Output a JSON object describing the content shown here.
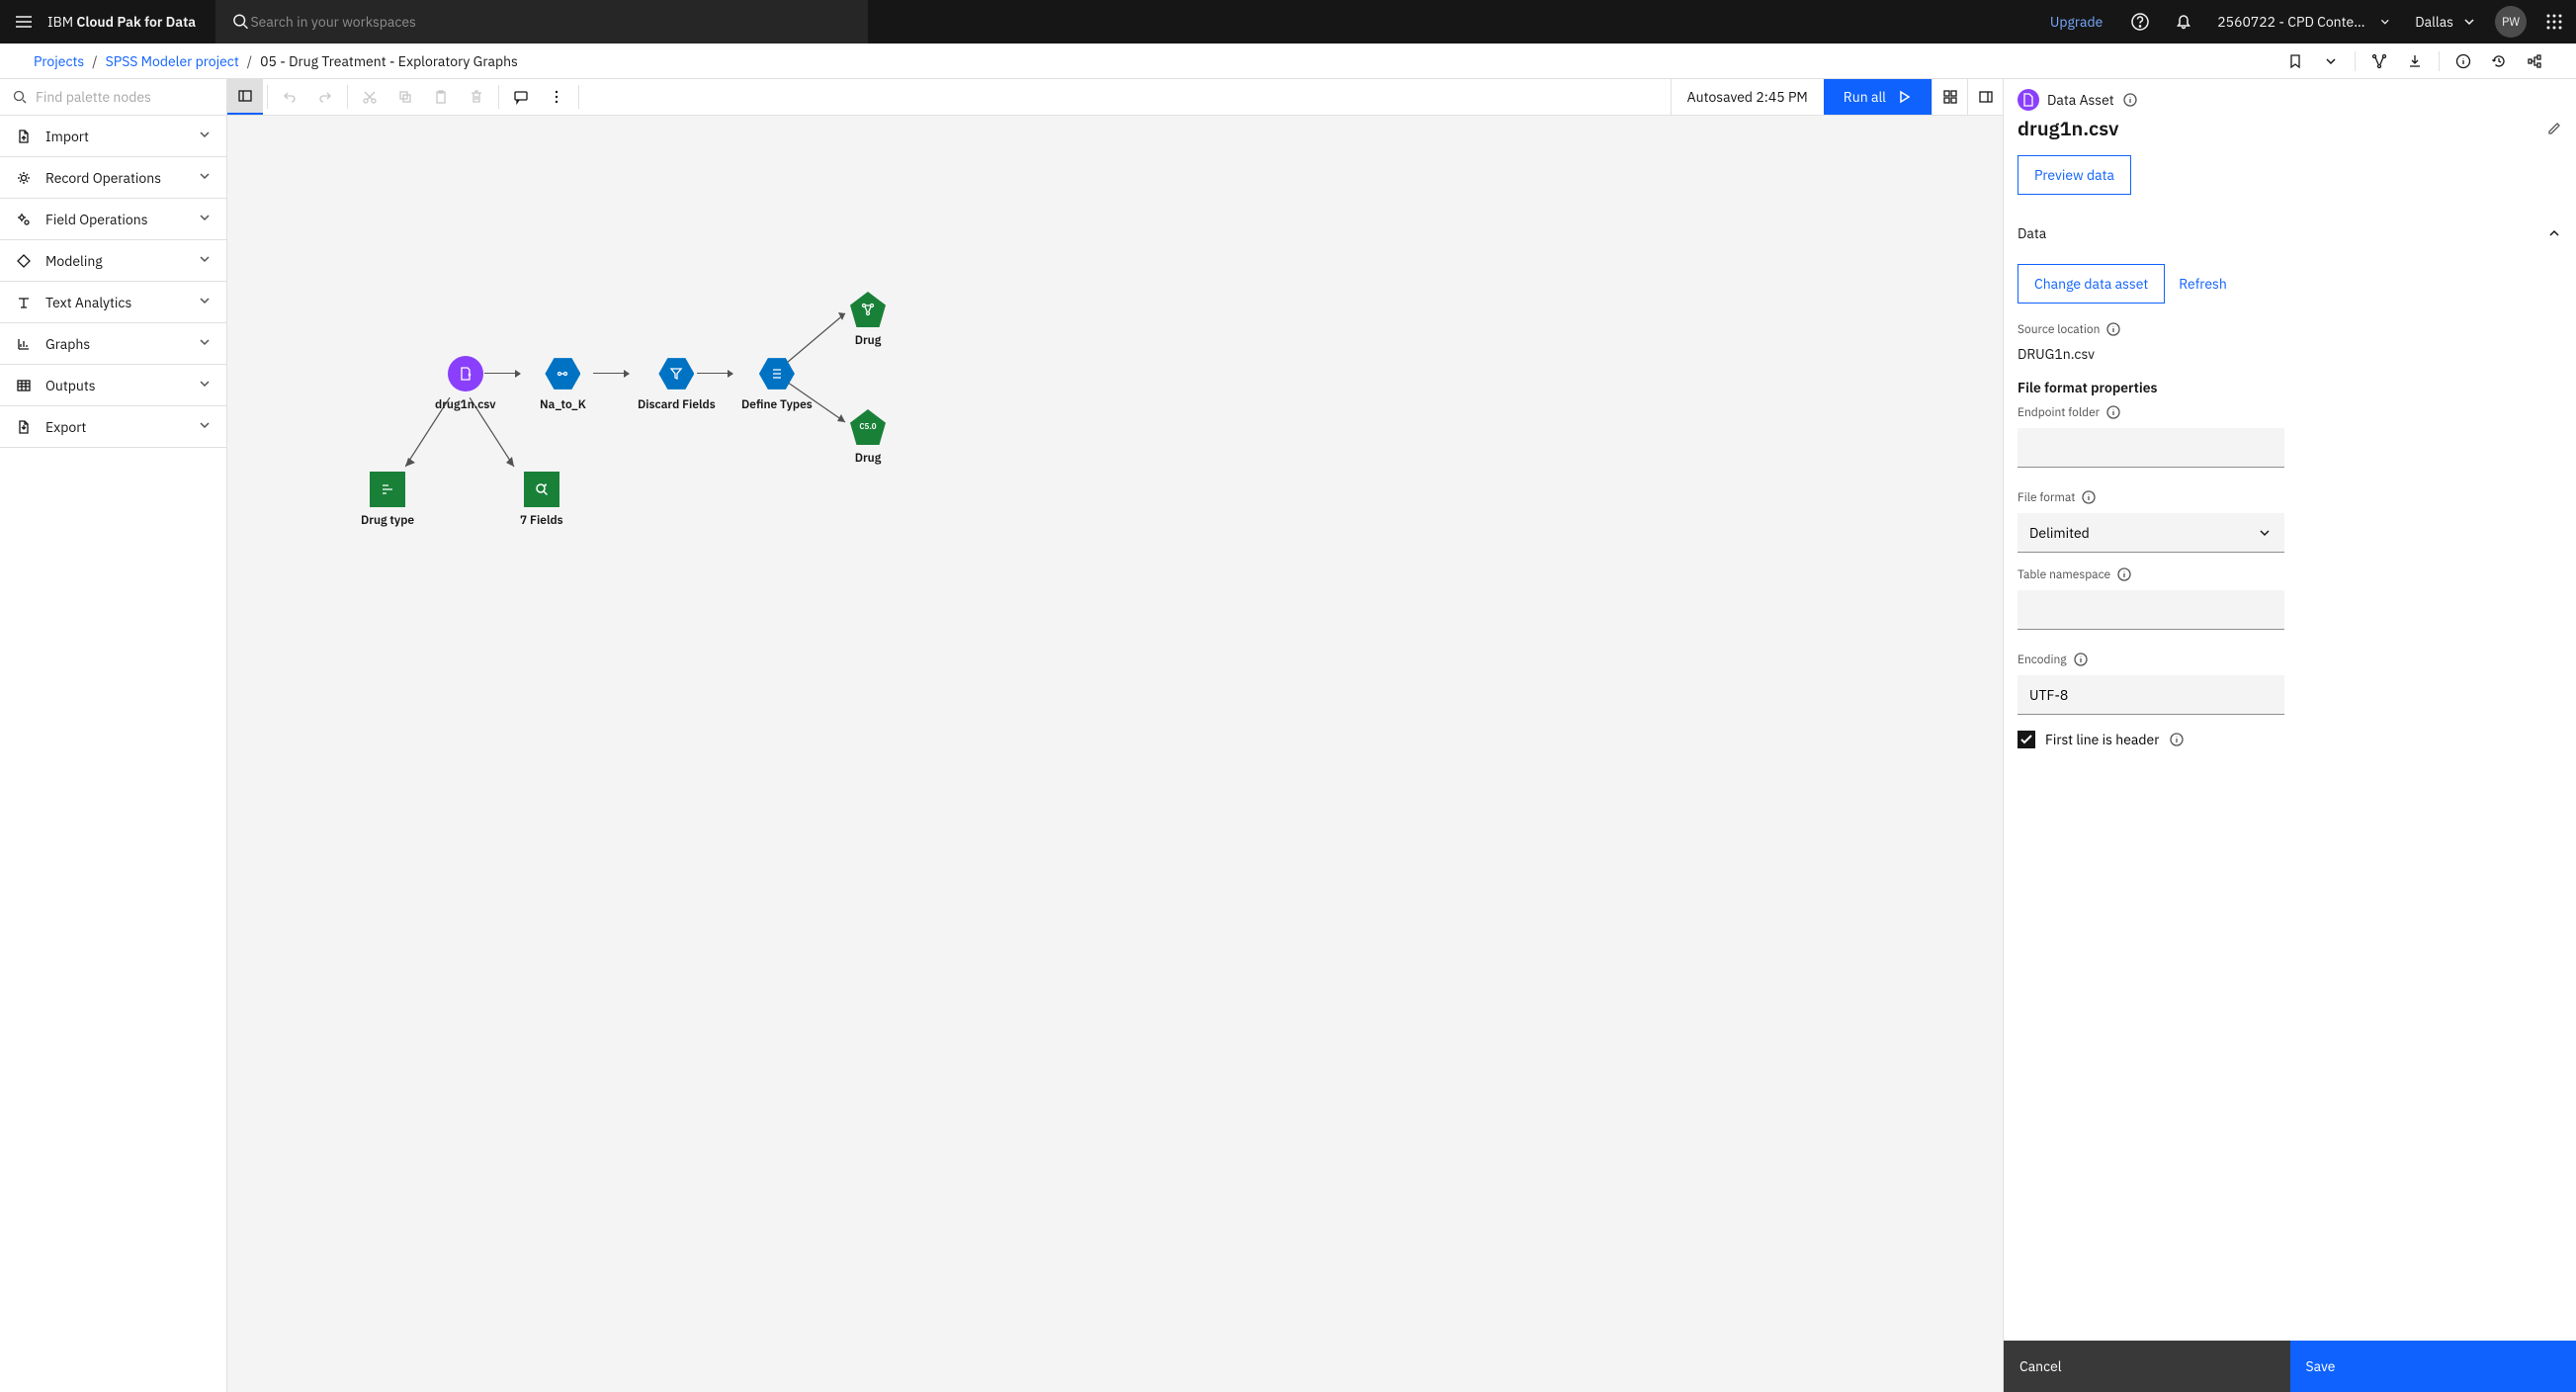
{
  "header": {
    "brand_thin": "IBM ",
    "brand_bold": "Cloud Pak for Data",
    "search_placeholder": "Search in your workspaces",
    "upgrade": "Upgrade",
    "workspace": "2560722 - CPD Content De...",
    "region": "Dallas",
    "avatar": "PW"
  },
  "breadcrumbs": {
    "projects": "Projects",
    "project": "SPSS Modeler project",
    "current": "05 - Drug Treatment - Exploratory Graphs"
  },
  "palette_search_placeholder": "Find palette nodes",
  "palette": [
    "Import",
    "Record Operations",
    "Field Operations",
    "Modeling",
    "Text Analytics",
    "Graphs",
    "Outputs",
    "Export"
  ],
  "toolbar": {
    "autosaved": "Autosaved 2:45 PM",
    "run_all": "Run all"
  },
  "flow": {
    "nodes": {
      "drug_csv": "drug1n.csv",
      "na_to_k": "Na_to_K",
      "discard": "Discard Fields",
      "define": "Define Types",
      "drug1": "Drug",
      "drug2": "Drug",
      "drug_type": "Drug type",
      "seven_fields": "7 Fields"
    }
  },
  "details": {
    "type": "Data Asset",
    "title": "drug1n.csv",
    "preview": "Preview data",
    "section_data": "Data",
    "change_asset": "Change data asset",
    "refresh": "Refresh",
    "source_location_label": "Source location",
    "source_location_value": "DRUG1n.csv",
    "file_format_props": "File format properties",
    "endpoint_label": "Endpoint folder",
    "file_format_label": "File format",
    "file_format_value": "Delimited",
    "table_ns_label": "Table namespace",
    "encoding_label": "Encoding",
    "encoding_value": "UTF-8",
    "first_line_header": "First line is header",
    "cancel": "Cancel",
    "save": "Save"
  }
}
